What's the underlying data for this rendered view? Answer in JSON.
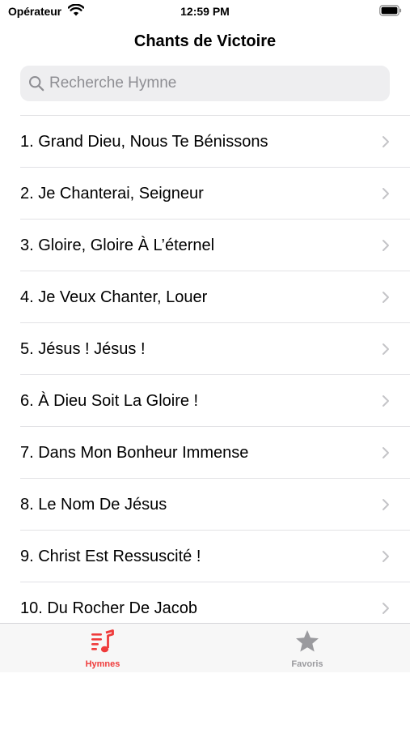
{
  "status_bar": {
    "carrier": "Opérateur",
    "time": "12:59 PM"
  },
  "nav": {
    "title": "Chants de Victoire"
  },
  "search": {
    "placeholder": "Recherche Hymne",
    "value": ""
  },
  "hymns": [
    "1. Grand Dieu, Nous Te Bénissons",
    "2. Je Chanterai, Seigneur",
    "3. Gloire, Gloire À L’éternel",
    "4. Je Veux Chanter, Louer",
    "5. Jésus ! Jésus !",
    "6. À Dieu Soit La Gloire !",
    "7. Dans Mon Bonheur Immense",
    "8. Le Nom De Jésus",
    "9. Christ Est Ressuscité !",
    "10. Du Rocher De Jacob"
  ],
  "tab_bar": {
    "tabs": [
      {
        "label": "Hymnes",
        "icon": "music-list-icon",
        "selected": true
      },
      {
        "label": "Favoris",
        "icon": "star-icon",
        "selected": false
      }
    ]
  },
  "colors": {
    "accent": "#ef3b3b",
    "inactive": "#9a9a9e",
    "search_bg": "#eeeef0",
    "separator": "#e2e2e5",
    "chevron": "#c4c4c7"
  }
}
